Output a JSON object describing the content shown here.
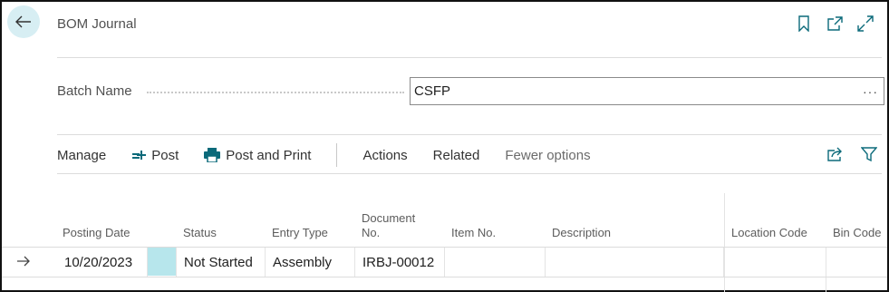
{
  "page": {
    "title": "BOM Journal"
  },
  "icons": {
    "back": "arrow-left-icon",
    "bookmark": "bookmark-icon",
    "open_new": "open-in-new-window-icon",
    "expand": "expand-icon",
    "post": "post-icon",
    "post_print": "printer-icon",
    "share": "share-icon",
    "filter": "filter-icon",
    "row_indicator": "arrow-right-icon"
  },
  "batch": {
    "label": "Batch Name",
    "value": "CSFP",
    "more": "···"
  },
  "actionbar": {
    "manage": "Manage",
    "post": "Post",
    "post_print": "Post and Print",
    "actions": "Actions",
    "related": "Related",
    "fewer": "Fewer options"
  },
  "table": {
    "headers": {
      "posting_date": "Posting Date",
      "status": "Status",
      "entry_type": "Entry Type",
      "document_no_1": "Document",
      "document_no_2": "No.",
      "item_no": "Item No.",
      "description": "Description",
      "location_code": "Location Code",
      "bin_code": "Bin Code"
    },
    "rows": [
      {
        "posting_date": "10/20/2023",
        "status": "Not Started",
        "entry_type": "Assembly",
        "document_no": "IRBJ-00012",
        "item_no": "",
        "description": "",
        "location_code": "",
        "bin_code": ""
      }
    ]
  },
  "colors": {
    "accent": "#0b6a7a",
    "back_bg": "#d7eef3",
    "selected_cell": "#b7e6ec"
  }
}
